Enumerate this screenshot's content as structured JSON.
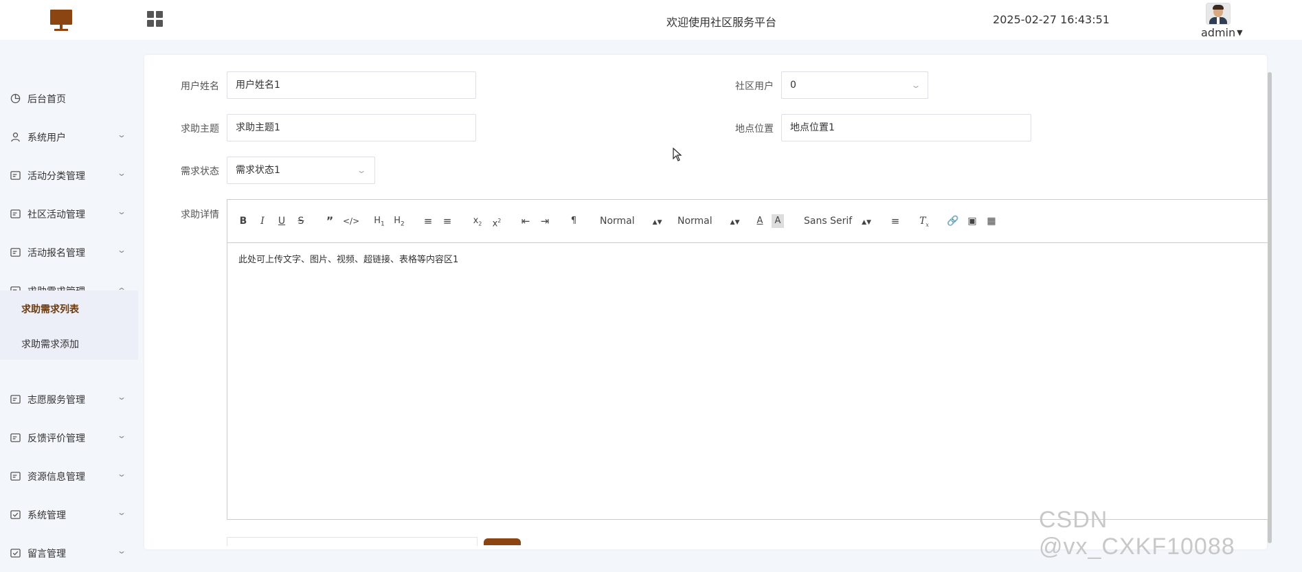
{
  "header": {
    "title": "欢迎使用社区服务平台",
    "datetime": "2025-02-27 16:43:51",
    "username": "admin",
    "brand_color": "#8b4513"
  },
  "sidebar": {
    "items": [
      {
        "label": "后台首页",
        "icon": "dashboard-icon"
      },
      {
        "label": "系统用户",
        "icon": "user-icon"
      },
      {
        "label": "活动分类管理",
        "icon": "list-icon"
      },
      {
        "label": "社区活动管理",
        "icon": "list-icon"
      },
      {
        "label": "活动报名管理",
        "icon": "list-icon"
      },
      {
        "label": "求助需求管理",
        "icon": "list-icon",
        "expanded": true
      },
      {
        "label": "志愿服务管理",
        "icon": "list-icon"
      },
      {
        "label": "反馈评价管理",
        "icon": "list-icon"
      },
      {
        "label": "资源信息管理",
        "icon": "list-icon"
      },
      {
        "label": "系统管理",
        "icon": "check-box-icon"
      },
      {
        "label": "留言管理",
        "icon": "check-box-icon"
      }
    ],
    "submenu": [
      {
        "label": "求助需求列表",
        "active": true
      },
      {
        "label": "求助需求添加",
        "active": false
      }
    ],
    "active_color": "#6b3a0f"
  },
  "form": {
    "username_label": "用户姓名",
    "username_value": "用户姓名1",
    "community_user_label": "社区用户",
    "community_user_value": "0",
    "subject_label": "求助主题",
    "subject_value": "求助主题1",
    "location_label": "地点位置",
    "location_value": "地点位置1",
    "status_label": "需求状态",
    "status_value": "需求状态1",
    "detail_label": "求助详情"
  },
  "editor": {
    "header_dropdown": "Normal",
    "size_dropdown": "Normal",
    "font_dropdown": "Sans Serif",
    "content": "此处可上传文字、图片、视频、超链接、表格等内容区1"
  },
  "watermark": "CSDN @vx_CXKF10088"
}
